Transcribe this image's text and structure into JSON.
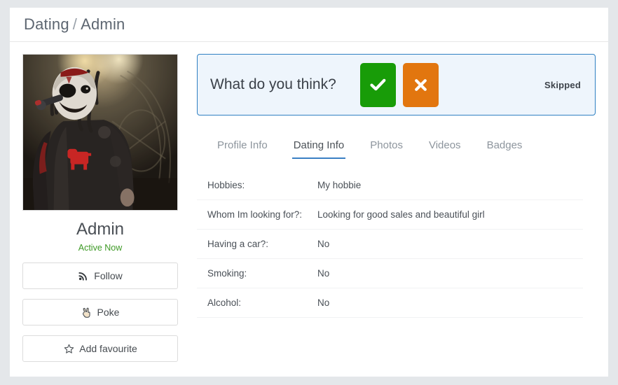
{
  "header": {
    "breadcrumb_root": "Dating",
    "breadcrumb_sep": "/",
    "breadcrumb_current": "Admin"
  },
  "profile": {
    "photo_alt": "profile-photo",
    "name": "Admin",
    "status": "Active Now",
    "actions": [
      {
        "label": "Follow",
        "icon": "rss-icon"
      },
      {
        "label": "Poke",
        "icon": "hand-victory-icon"
      },
      {
        "label": "Add favourite",
        "icon": "star-outline-icon"
      }
    ]
  },
  "rating_panel": {
    "question": "What do you think?",
    "yes_icon": "check-icon",
    "no_icon": "cross-icon",
    "status": "Skipped",
    "border_color": "#2f80c2",
    "background_color": "#eef5fc",
    "yes_color": "#189c08",
    "no_color": "#e2760f"
  },
  "tabs": [
    {
      "label": "Profile Info",
      "active": false
    },
    {
      "label": "Dating Info",
      "active": true
    },
    {
      "label": "Photos",
      "active": false
    },
    {
      "label": "Videos",
      "active": false
    },
    {
      "label": "Badges",
      "active": false
    }
  ],
  "dating_info": [
    {
      "key": "Hobbies:",
      "value": "My hobbie"
    },
    {
      "key": "Whom Im looking for?:",
      "value": "Looking for good sales and beautiful girl"
    },
    {
      "key": "Having a car?:",
      "value": "No"
    },
    {
      "key": "Smoking:",
      "value": "No"
    },
    {
      "key": "Alcohol:",
      "value": "No"
    }
  ]
}
